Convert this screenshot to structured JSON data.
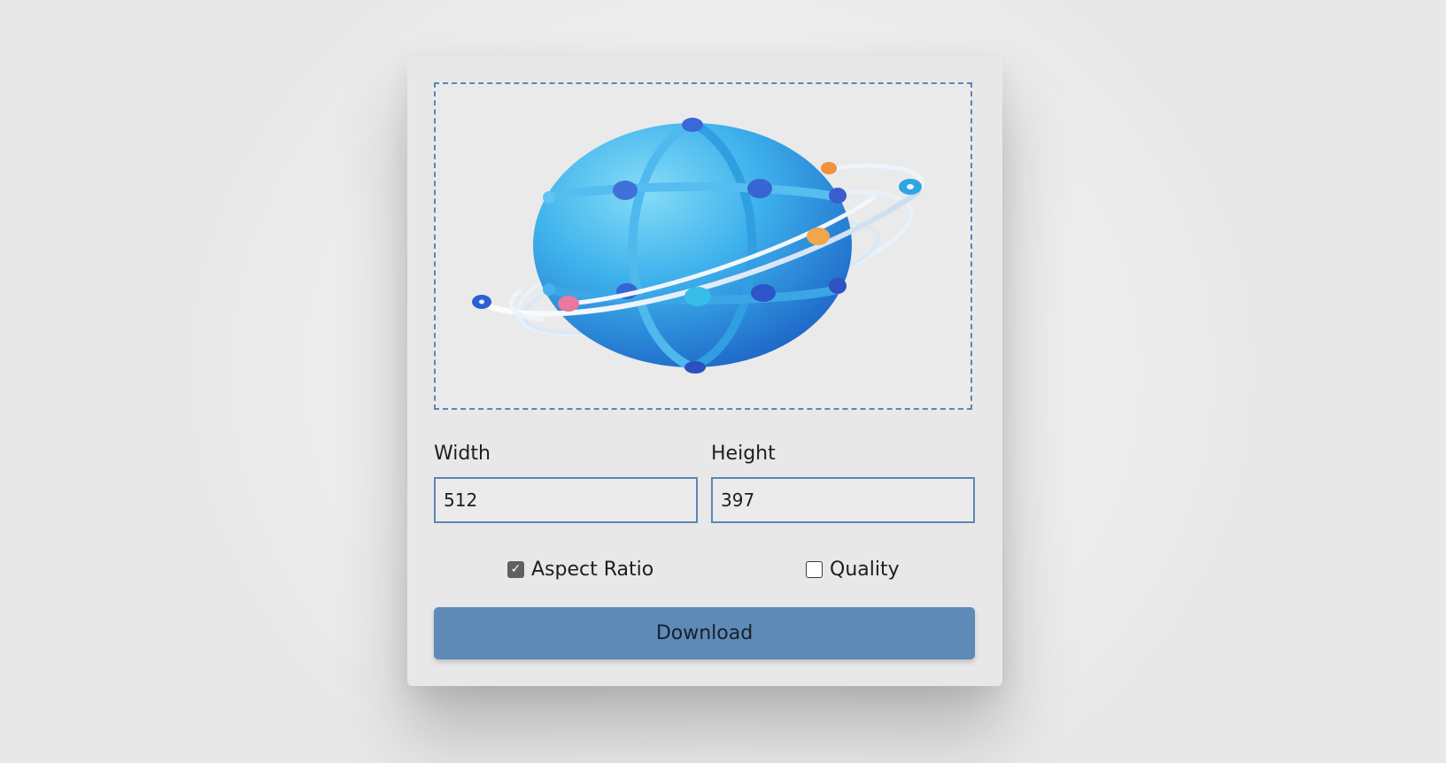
{
  "colors": {
    "accent": "#5e8ab7",
    "border": "#5d86b3",
    "card_background": "#e8e8e8"
  },
  "preview": {
    "image_description_icon": "globe-with-orbit-rings-icon"
  },
  "width": {
    "label": "Width",
    "value": "512"
  },
  "height": {
    "label": "Height",
    "value": "397"
  },
  "options": {
    "aspect_ratio": {
      "label": "Aspect Ratio",
      "checked": true
    },
    "quality": {
      "label": "Quality",
      "checked": false
    }
  },
  "download": {
    "label": "Download"
  }
}
